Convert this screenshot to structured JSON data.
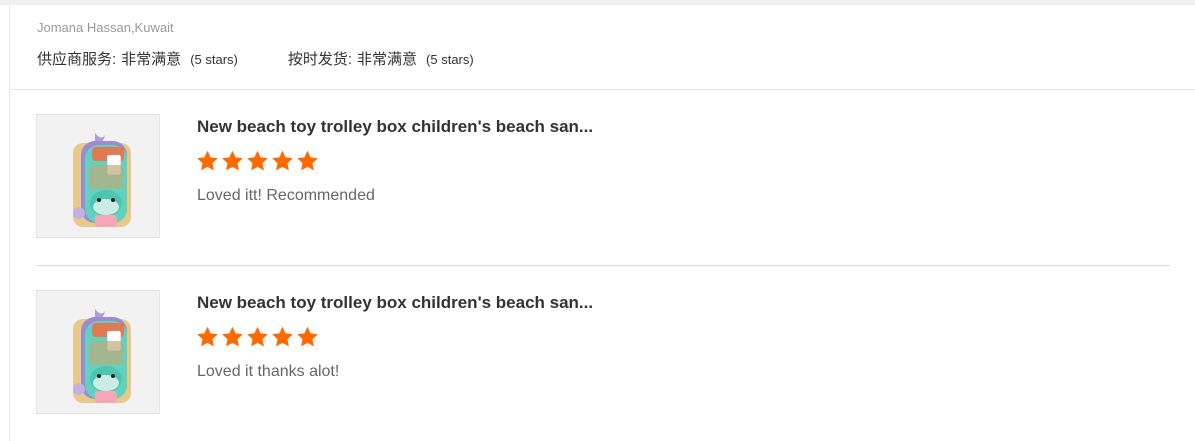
{
  "reviewer": "Jomana Hassan,Kuwait",
  "ratings": [
    {
      "label": "供应商服务:",
      "value": "非常满意",
      "stars": "(5 stars)"
    },
    {
      "label": "按时发货:",
      "value": "非常满意",
      "stars": "(5 stars)"
    }
  ],
  "accent_color": "#ff6a00",
  "reviews": [
    {
      "product_title": "New beach toy trolley box children's beach san...",
      "rating": 5,
      "comment": "Loved itt! Recommended",
      "thumbnail_icon": "product-thumbnail"
    },
    {
      "product_title": "New beach toy trolley box children's beach san...",
      "rating": 5,
      "comment": "Loved it thanks alot!",
      "thumbnail_icon": "product-thumbnail"
    }
  ]
}
